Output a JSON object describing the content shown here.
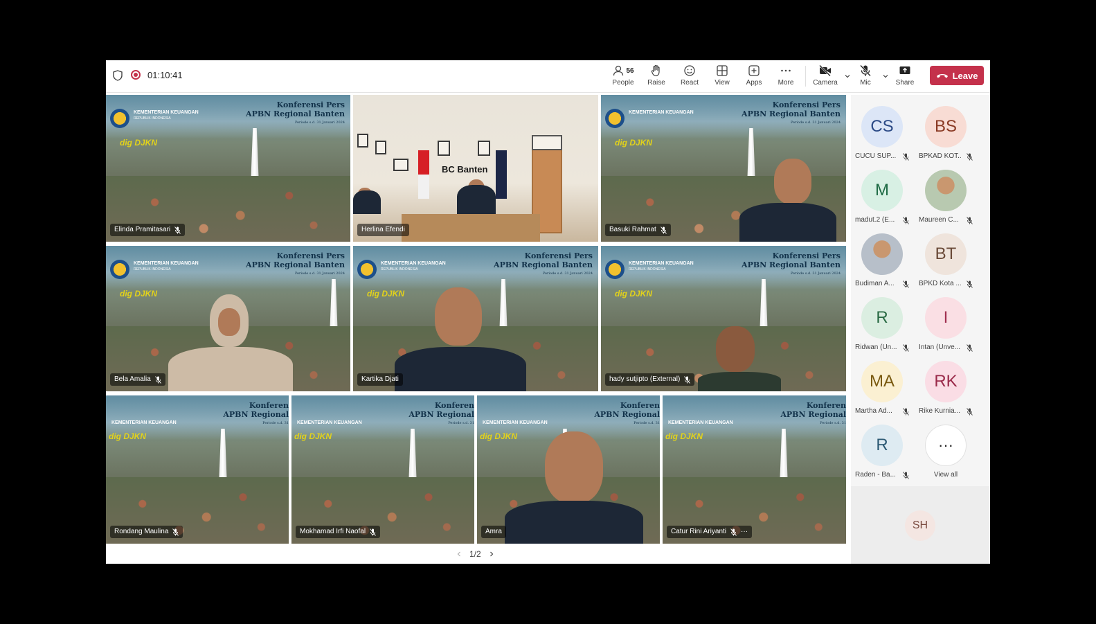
{
  "topbar": {
    "timer": "01:10:41",
    "people_count": "56",
    "buttons": {
      "people": "People",
      "raise": "Raise",
      "react": "React",
      "view": "View",
      "apps": "Apps",
      "more": "More",
      "camera": "Camera",
      "mic": "Mic",
      "share": "Share",
      "leave": "Leave"
    }
  },
  "slide": {
    "org": "KEMENTERIAN KEUANGAN",
    "org_sub": "REPUBLIK INDONESIA",
    "title_line1": "Konferensi Pers",
    "title_line2": "APBN Regional Banten",
    "title_line3": "Periode s.d. 31 Januari 2024",
    "cut_line1": "Konferen",
    "cut_line2": "APBN Regional",
    "cut_line3": "Periode s.d. 31",
    "djkn": "DJKN",
    "dig_djkn": "dig DJKN"
  },
  "office": {
    "logo": "BC Banten"
  },
  "tiles": [
    {
      "name": "Elinda Pramitasari"
    },
    {
      "name": "Herlina Efendi"
    },
    {
      "name": "Basuki Rahmat"
    },
    {
      "name": "Bela Amalia"
    },
    {
      "name": "Kartika Djati"
    },
    {
      "name": "hady sutjipto (External)"
    },
    {
      "name": "Rondang Maulina"
    },
    {
      "name": "Mokhamad Irfi Naofal"
    },
    {
      "name": "Amra"
    },
    {
      "name": "Catur Rini Ariyanti"
    }
  ],
  "tile_more": "···",
  "pager": {
    "label": "1/2"
  },
  "participants": [
    {
      "initials": "CS",
      "name": "CUCU SUP...",
      "bg": "#dce6f7",
      "fg": "#2b4a86"
    },
    {
      "initials": "BS",
      "name": "BPKAD KOT...",
      "bg": "#f8dcd4",
      "fg": "#8a3a24"
    },
    {
      "initials": "M",
      "name": "madut.2 (E...",
      "bg": "#d8f0e4",
      "fg": "#1e6a44"
    },
    {
      "initials": "",
      "name": "Maureen C...",
      "bg": "#b8c9b0",
      "fg": "#333333"
    },
    {
      "initials": "",
      "name": "Budiman A...",
      "bg": "#b7bfc9",
      "fg": "#333333"
    },
    {
      "initials": "BT",
      "name": "BPKD Kota ...",
      "bg": "#efe4dc",
      "fg": "#6a4a38"
    },
    {
      "initials": "R",
      "name": "Ridwan (Un...",
      "bg": "#dbeee1",
      "fg": "#2a6a44"
    },
    {
      "initials": "I",
      "name": "Intan (Unve...",
      "bg": "#fadfe4",
      "fg": "#a03050"
    },
    {
      "initials": "MA",
      "name": "Martha Ad...",
      "bg": "#fbf0d2",
      "fg": "#7a5a10"
    },
    {
      "initials": "RK",
      "name": "Rike Kurnia...",
      "bg": "#fadde5",
      "fg": "#9a2a4a"
    },
    {
      "initials": "R",
      "name": "Raden - Ba...",
      "bg": "#deebf2",
      "fg": "#2d5a74"
    }
  ],
  "view_all": {
    "label": "View all",
    "glyph": "···"
  },
  "extra_participant": {
    "initials": "SH"
  }
}
